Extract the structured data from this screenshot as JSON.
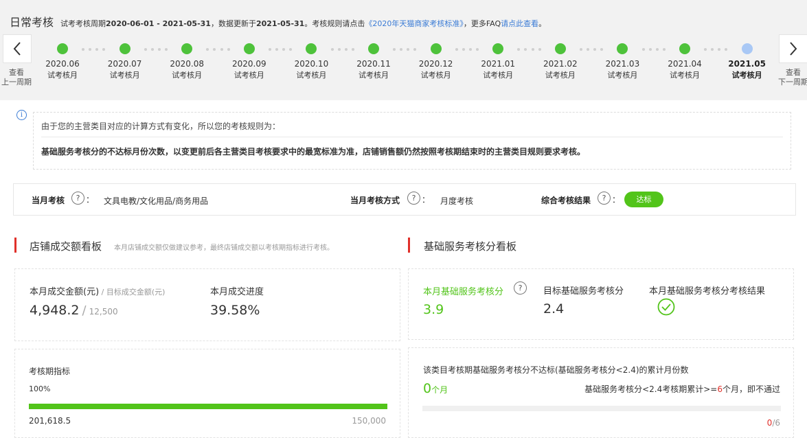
{
  "header": {
    "title": "日常考核",
    "desc_prefix": "试考考核周期",
    "period": "2020-06-01 - 2021-05-31",
    "desc_mid": "，数据更新于",
    "update_date": "2021-05-31",
    "desc_rule": "。考核规则请点击",
    "rule_link": "《2020年天猫商家考核标准》",
    "desc_faq": "，更多FAQ",
    "faq_link": "请点此查看",
    "desc_end": "。"
  },
  "nav": {
    "prev_label_1": "查看",
    "prev_label_2": "上一周期",
    "next_label_1": "查看",
    "next_label_2": "下一周期",
    "prev_icon": "chevron-left-icon",
    "next_icon": "chevron-right-icon"
  },
  "timeline": [
    {
      "date": "2020.06",
      "label": "试考核月",
      "status": "done"
    },
    {
      "date": "2020.07",
      "label": "试考核月",
      "status": "done"
    },
    {
      "date": "2020.08",
      "label": "试考核月",
      "status": "done"
    },
    {
      "date": "2020.09",
      "label": "试考核月",
      "status": "done"
    },
    {
      "date": "2020.10",
      "label": "试考核月",
      "status": "done"
    },
    {
      "date": "2020.11",
      "label": "试考核月",
      "status": "done"
    },
    {
      "date": "2020.12",
      "label": "试考核月",
      "status": "done"
    },
    {
      "date": "2021.01",
      "label": "试考核月",
      "status": "done"
    },
    {
      "date": "2021.02",
      "label": "试考核月",
      "status": "done"
    },
    {
      "date": "2021.03",
      "label": "试考核月",
      "status": "done"
    },
    {
      "date": "2021.04",
      "label": "试考核月",
      "status": "done"
    },
    {
      "date": "2021.05",
      "label": "试考核月",
      "status": "current"
    }
  ],
  "notice": {
    "icon": "info-icon",
    "line1": "由于您的主营类目对应的计算方式有变化，所以您的考核规则为：",
    "line2": "基础服务考核分的不达标月份次数，以变更前后各主营类目考核要求中的最宽标准为准，店铺销售额仍然按照考核期结束时的主营类目规则要求考核。"
  },
  "summary": {
    "month_label": "当月考核",
    "month_value": "文具电教/文化用品/商务用品",
    "method_label": "当月考核方式",
    "method_value": "月度考核",
    "result_label": "综合考核结果",
    "result_badge": "达标",
    "colon": "：",
    "help_icon": "?"
  },
  "sales_board": {
    "title": "店铺成交额看板",
    "note": "本月店铺成交额仅做建议参考，最终店铺成交额以考核期指标进行考核。",
    "amount_label": "本月成交金额(元)",
    "target_label": " / 目标成交金额(元)",
    "amount_value": "4,948.2",
    "target_value": "12,500",
    "progress_label": "本月成交进度",
    "progress_value": "39.58%",
    "period_label": "考核期指标",
    "period_percent": "100%",
    "period_fill": 1.0,
    "period_actual": "201,618.5",
    "period_target": "150,000"
  },
  "service_board": {
    "title": "基础服务考核分看板",
    "score_label": "本月基础服务考核分",
    "score_value": "3.9",
    "target_label": "目标基础服务考核分",
    "target_value": "2.4",
    "result_label": "本月基础服务考核分考核结果",
    "result_icon": "check-circle-icon",
    "fail_title": "该类目考核期基础服务考核分不达标(基础服务考核分<2.4)的累计月份数",
    "fail_count": "0",
    "fail_unit": "个月",
    "rule_prefix": "基础服务考核分<2.4考核期累计>=",
    "rule_num": "6",
    "rule_suffix": "个月，即不通过",
    "progress_current": "0",
    "progress_total": "/6",
    "progress_fill": 0.0
  },
  "colors": {
    "green": "#52c41a",
    "accent_red": "#e0302a",
    "link_blue": "#3a7bd5",
    "pending_dot": "#a9c8f5"
  }
}
